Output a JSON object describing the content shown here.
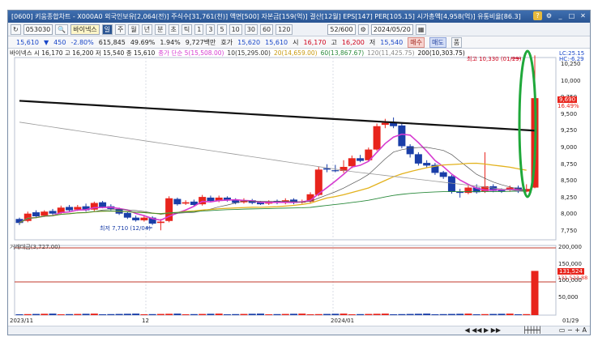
{
  "titlebar": {
    "text": "[0600] 키움종합차트 - X000A0 외국인보유[2,064(전)] 주식수[31,761(천)] 액면[500] 자본금[159(억)] 결산[12월] EPS[147] PER[105.15] 시가총액[4,958(억)] 유통비율[86.3]"
  },
  "toolbar1": {
    "code": "053030",
    "name": "바이넥스",
    "periods": [
      "일",
      "주",
      "월",
      "년",
      "분",
      "초",
      "틱"
    ],
    "intervals": [
      "1",
      "3",
      "5",
      "10",
      "30",
      "60",
      "120"
    ],
    "count": "52/600",
    "date": "2024/05/20"
  },
  "quote": {
    "price": "15,610",
    "change_arrow": "▼",
    "change": "450",
    "change_pct": "-2.80%",
    "volume": "615,845",
    "vol_ratio": "49.69%",
    "turnover": "1.94%",
    "trade_value": "9,727백만",
    "ho_label": "호가",
    "ho_value": "15,620",
    "ask": "15,610",
    "open_label": "시",
    "open": "16,170",
    "high_label": "고",
    "high": "16,200",
    "low_label": "저",
    "low": "15,540",
    "buy_label": "매수",
    "sell_label": "매도"
  },
  "legend": {
    "price_info": "바이넥스 시 16,170 고 16,200 저 15,540 종 15,610",
    "ma5": "종가 단순 5(15,508.00)",
    "ma10": "10(15,295.00)",
    "ma20": "20(14,659.00)",
    "ma60": "60(13,867.67)",
    "ma120": "120(11,425.75)",
    "ma200": "200(10,303.75)"
  },
  "price_axis": {
    "ticks": [
      "10,250",
      "10,000",
      "9,750",
      "9,500",
      "9,250",
      "9,000",
      "8,750",
      "8,500",
      "8,250",
      "8,000",
      "7,750"
    ],
    "lc": "LC:25.15",
    "hc": "HC:-6.29",
    "current_label": "9,690",
    "current_pct": "16.49%"
  },
  "annotations": {
    "high": "최고 10,330 (01/29)",
    "low": "최저 7,710 (12/04)"
  },
  "volume_panel": {
    "title": "거래대금(3,727.00)",
    "ticks": [
      "200,000",
      "150,000",
      "100,000",
      "50,000"
    ],
    "current": "131,524",
    "current2": "131,523.88"
  },
  "date_axis": [
    "2023/11",
    "12",
    "2024/01",
    "01/29"
  ],
  "colors": {
    "up": "#e8241c",
    "down": "#1a3ea8",
    "ma5": "#d63bd0",
    "ma20": "#e3b21d",
    "ma60": "#2a8a3c",
    "ma200": "#111111",
    "highlight": "#1fa83a"
  }
}
